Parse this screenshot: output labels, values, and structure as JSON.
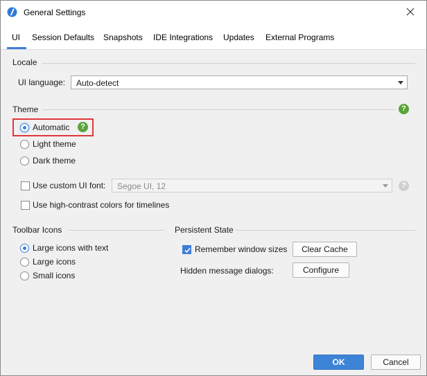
{
  "window": {
    "title": "General Settings"
  },
  "tabs": [
    {
      "label": "UI",
      "active": true
    },
    {
      "label": "Session Defaults"
    },
    {
      "label": "Snapshots"
    },
    {
      "label": "IDE Integrations"
    },
    {
      "label": "Updates"
    },
    {
      "label": "External Programs"
    }
  ],
  "locale": {
    "section_title": "Locale",
    "ui_language_label": "UI language:",
    "ui_language_value": "Auto-detect"
  },
  "theme": {
    "section_title": "Theme",
    "options": [
      {
        "label": "Automatic",
        "selected": true
      },
      {
        "label": "Light theme",
        "selected": false
      },
      {
        "label": "Dark theme",
        "selected": false
      }
    ],
    "custom_font_label": "Use custom UI font:",
    "custom_font_checked": false,
    "custom_font_value": "Segoe UI, 12",
    "high_contrast_label": "Use high-contrast colors for timelines",
    "high_contrast_checked": false
  },
  "toolbar_icons": {
    "section_title": "Toolbar Icons",
    "options": [
      {
        "label": "Large icons with text",
        "selected": true
      },
      {
        "label": "Large icons",
        "selected": false
      },
      {
        "label": "Small icons",
        "selected": false
      }
    ]
  },
  "persistent_state": {
    "section_title": "Persistent State",
    "remember_label": "Remember window sizes",
    "remember_checked": true,
    "clear_cache_label": "Clear Cache",
    "hidden_dialogs_label": "Hidden message dialogs:",
    "configure_label": "Configure"
  },
  "footer": {
    "ok_label": "OK",
    "cancel_label": "Cancel"
  },
  "colors": {
    "accent": "#3d7ed6",
    "help_icon": "#5aa33a",
    "highlight_box": "#e0373a"
  },
  "icons": {
    "app": "app-icon",
    "close": "close-icon",
    "help": "help-icon",
    "dropdown": "chevron-down-icon"
  }
}
